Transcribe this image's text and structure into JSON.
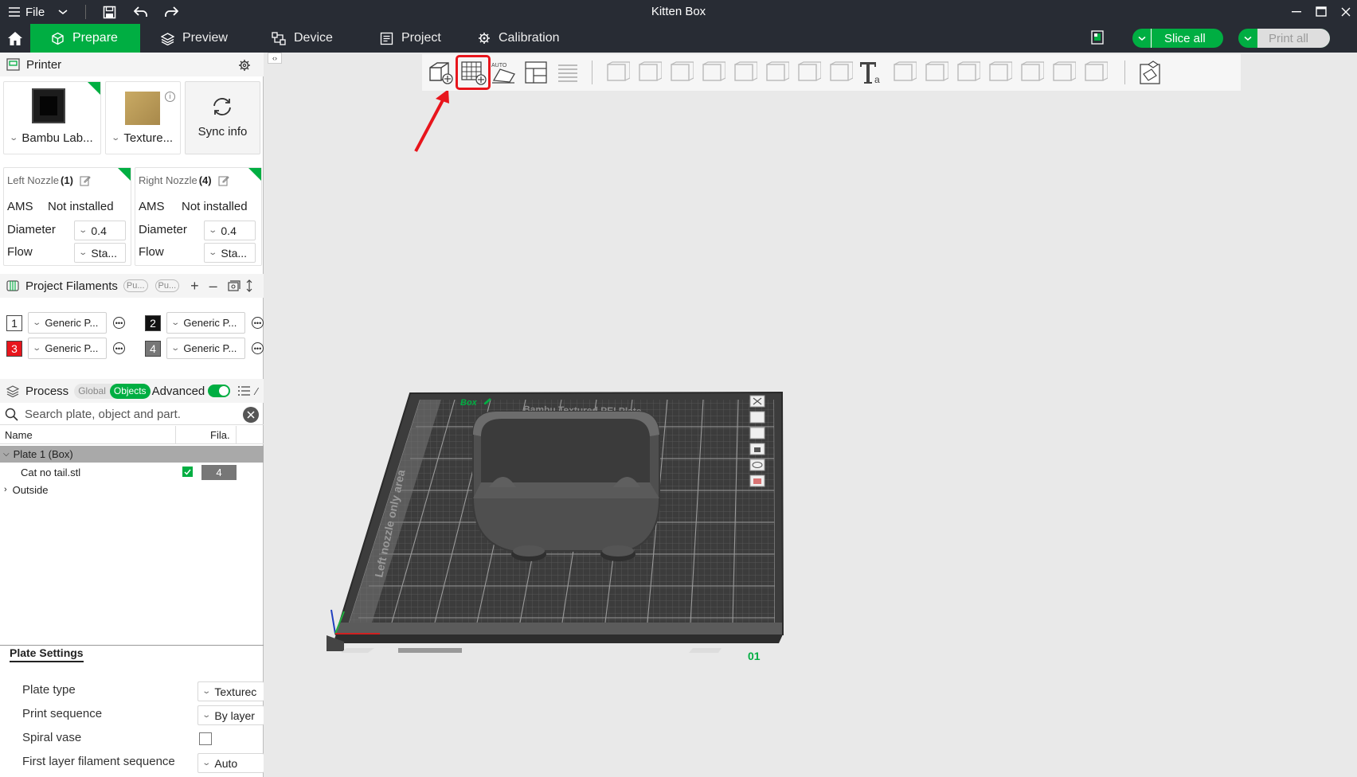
{
  "window": {
    "title": "Kitten Box",
    "file_menu": "File"
  },
  "nav": {
    "tabs": [
      {
        "label": "Prepare"
      },
      {
        "label": "Preview"
      },
      {
        "label": "Device"
      },
      {
        "label": "Project"
      },
      {
        "label": "Calibration"
      }
    ],
    "slice_all": "Slice all",
    "print_all": "Print all"
  },
  "printer": {
    "header": "Printer",
    "printer_name": "Bambu Lab...",
    "plate_name": "Texture...",
    "sync_info": "Sync info"
  },
  "nozzles": {
    "left": {
      "title": "Left Nozzle",
      "count": "(1)",
      "ams_label": "AMS",
      "ams_value": "Not installed",
      "diameter_label": "Diameter",
      "diameter_value": "0.4",
      "flow_label": "Flow",
      "flow_value": "Sta..."
    },
    "right": {
      "title": "Right Nozzle",
      "count": "(4)",
      "ams_label": "AMS",
      "ams_value": "Not installed",
      "diameter_label": "Diameter",
      "diameter_value": "0.4",
      "flow_label": "Flow",
      "flow_value": "Sta..."
    }
  },
  "filaments": {
    "header": "Project Filaments",
    "chip1": "Pu...",
    "chip2": "Pu...",
    "items": [
      {
        "num": "1",
        "name": "Generic P...",
        "color": "#ffffff",
        "text_color": "#222222"
      },
      {
        "num": "2",
        "name": "Generic P...",
        "color": "#111111",
        "text_color": "#ffffff"
      },
      {
        "num": "3",
        "name": "Generic P...",
        "color": "#e8151c",
        "text_color": "#ffffff"
      },
      {
        "num": "4",
        "name": "Generic P...",
        "color": "#777777",
        "text_color": "#ffffff"
      }
    ]
  },
  "process": {
    "header": "Process",
    "toggle_global": "Global",
    "toggle_objects": "Objects",
    "advanced": "Advanced",
    "search_placeholder": "Search plate, object and part.",
    "col_name": "Name",
    "col_fila": "Fila.",
    "plate_row": "Plate 1 (Box)",
    "object_row": "Cat no tail.stl",
    "object_fila": "4",
    "outside_row": "Outside"
  },
  "plate_settings": {
    "tab": "Plate Settings",
    "rows": [
      {
        "label": "Plate type",
        "value": "Texturec"
      },
      {
        "label": "Print sequence",
        "value": "By layer"
      },
      {
        "label": "Spiral vase",
        "value": ""
      },
      {
        "label": "First layer filament sequence",
        "value": "Auto"
      }
    ]
  },
  "viewport": {
    "plate_label": "Box",
    "plate_number": "01",
    "plate_text": "Bambu Textured PEI Plate",
    "left_area_text": "Left nozzle only area"
  },
  "colors": {
    "accent": "#00ae42",
    "titlebar": "#282c34",
    "highlight": "#e8151c"
  }
}
